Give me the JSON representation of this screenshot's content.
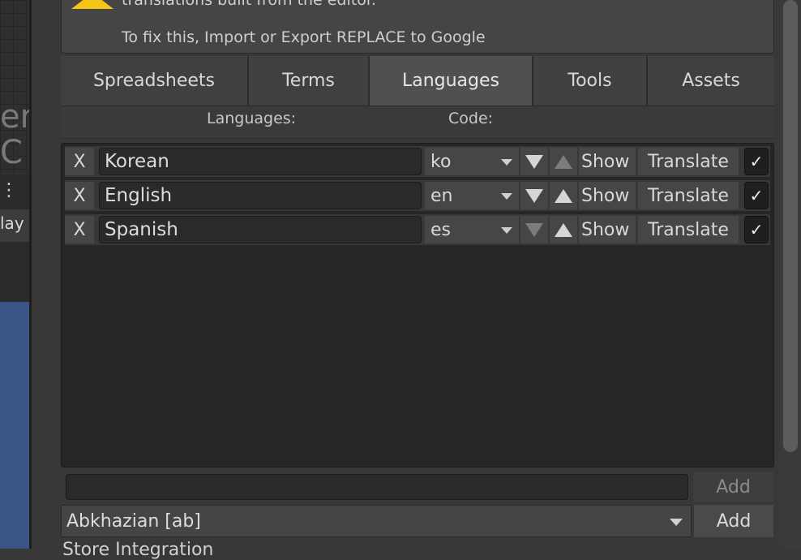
{
  "warning": {
    "line1": "translations built from the editor.",
    "line2": "To fix this, Import or Export REPLACE to Google"
  },
  "tabs": [
    {
      "label": "Spreadsheets",
      "active": false
    },
    {
      "label": "Terms",
      "active": false
    },
    {
      "label": "Languages",
      "active": true
    },
    {
      "label": "Tools",
      "active": false
    },
    {
      "label": "Assets",
      "active": false
    }
  ],
  "headers": {
    "languages": "Languages:",
    "code": "Code:"
  },
  "languages": [
    {
      "remove": "X",
      "name": "Korean",
      "code": "ko",
      "show": "Show",
      "translate": "Translate",
      "enabled": "✓"
    },
    {
      "remove": "X",
      "name": "English",
      "code": "en",
      "show": "Show",
      "translate": "Translate",
      "enabled": "✓"
    },
    {
      "remove": "X",
      "name": "Spanish",
      "code": "es",
      "show": "Show",
      "translate": "Translate",
      "enabled": "✓"
    }
  ],
  "add_custom": {
    "value": "",
    "button": "Add"
  },
  "add_known": {
    "selected": "Abkhazian [ab]",
    "button": "Add"
  },
  "bottom_text": "Store Integration",
  "left_strip": {
    "letters": "er\nC",
    "menu": "⋮",
    "play": "lay"
  }
}
